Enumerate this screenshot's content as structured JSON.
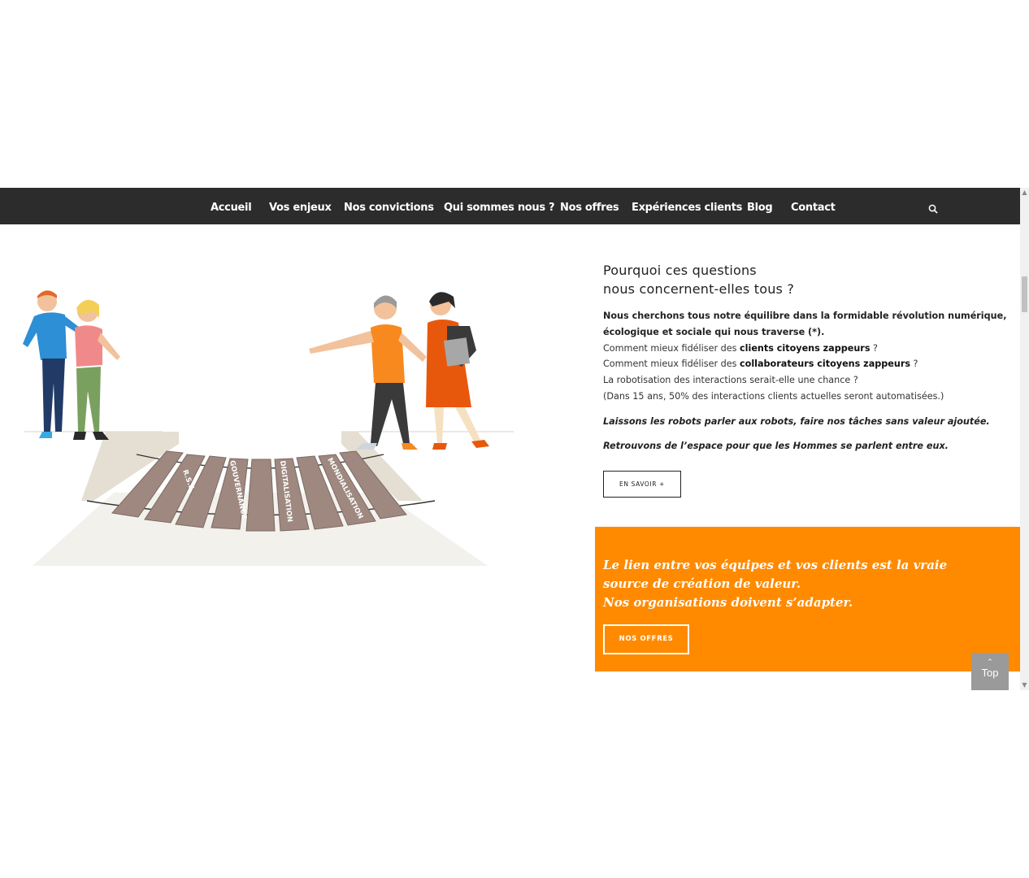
{
  "nav": {
    "items": [
      {
        "label": "Accueil"
      },
      {
        "label": "Vos enjeux"
      },
      {
        "label": "Nos convictions"
      },
      {
        "label": "Qui sommes nous ?"
      },
      {
        "label": "Nos offres"
      },
      {
        "label": "Expériences clients"
      },
      {
        "label": "Blog"
      },
      {
        "label": "Contact"
      }
    ],
    "search_icon": "search-icon",
    "background": "#2c2c2c"
  },
  "illustration": {
    "planks": [
      "R.S.E.",
      "GOUVERNANCE",
      "DIGITALISATION",
      "MONDIALISATION"
    ]
  },
  "section": {
    "title_line1": "Pourquoi ces questions",
    "title_line2": "nous concernent-elles tous ?",
    "intro": "Nous cherchons tous notre équilibre dans la formidable révolution numérique, écologique et sociale qui nous traverse (*).",
    "q1_prefix": "Comment mieux fidéliser des ",
    "q1_bold": "clients citoyens zappeurs",
    "q1_suffix": " ?",
    "q2_prefix": "Comment mieux fidéliser des ",
    "q2_bold": "collaborateurs citoyens zappeurs",
    "q2_suffix": " ?",
    "q3": "La robotisation des interactions serait-elle une chance ?",
    "q4": "(Dans 15 ans, 50% des interactions clients actuelles seront automatisées.)",
    "italic1": "Laissons les robots parler aux robots, faire nos tâches sans valeur ajoutée.",
    "italic2": "Retrouvons de l’espace pour que les Hommes se parlent entre eux.",
    "button_label": "EN SAVOIR +"
  },
  "orange": {
    "color": "#ff8a00",
    "quote_line1": "Le lien entre vos équipes et vos clients est la vraie source de création de valeur.",
    "quote_line2": "Nos organisations doivent s’adapter.",
    "button_label": "NOS OFFRES"
  },
  "top_button": {
    "chevron": "⌃",
    "label": "Top"
  },
  "scrollbar": {
    "up": "▲",
    "down": "▼"
  }
}
